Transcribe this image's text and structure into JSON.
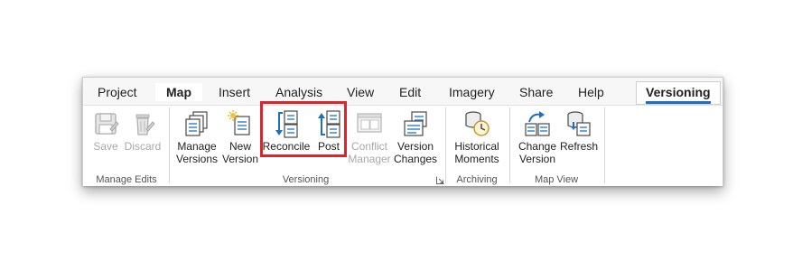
{
  "tabs": [
    "Project",
    "Map",
    "Insert",
    "Analysis",
    "View",
    "Edit",
    "Imagery",
    "Share",
    "Help"
  ],
  "active_tab": "Map",
  "context_tab": "Versioning",
  "groups": {
    "manage_edits": {
      "label": "Manage Edits",
      "save": "Save",
      "discard": "Discard"
    },
    "versioning": {
      "label": "Versioning",
      "manage_versions_1": "Manage",
      "manage_versions_2": "Versions",
      "new_version_1": "New",
      "new_version_2": "Version",
      "reconcile": "Reconcile",
      "post": "Post",
      "conflict_manager_1": "Conflict",
      "conflict_manager_2": "Manager",
      "version_changes_1": "Version",
      "version_changes_2": "Changes"
    },
    "archiving": {
      "label": "Archiving",
      "historical_moments_1": "Historical",
      "historical_moments_2": "Moments"
    },
    "map_view": {
      "label": "Map View",
      "change_version_1": "Change",
      "change_version_2": "Version",
      "refresh": "Refresh"
    }
  },
  "colors": {
    "accent": "#1e6fbf",
    "highlight": "#d9262c",
    "disabled_text": "#a8a8a8"
  }
}
